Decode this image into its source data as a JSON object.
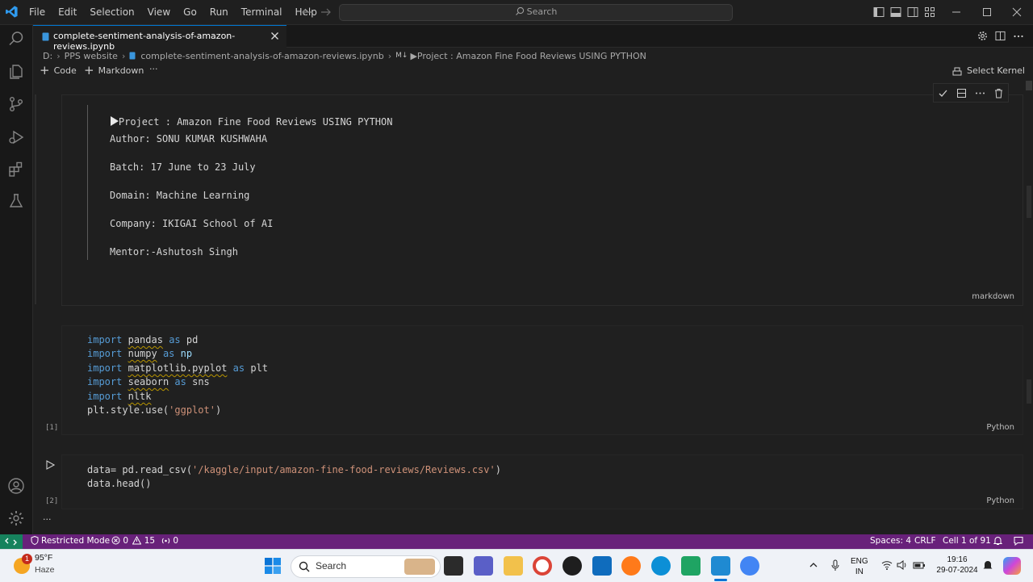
{
  "menu": [
    "File",
    "Edit",
    "Selection",
    "View",
    "Go",
    "Run",
    "Terminal",
    "Help"
  ],
  "search": {
    "label": "Search"
  },
  "tab": {
    "title": "complete-sentiment-analysis-of-amazon-reviews.ipynb"
  },
  "breadcrumb": {
    "drive": "D:",
    "folder": "PPS website",
    "file": "complete-sentiment-analysis-of-amazon-reviews.ipynb",
    "section_prefix": "M↓",
    "section": "▶Project : Amazon Fine Food Reviews USING PYTHON"
  },
  "toolbar": {
    "code": "Code",
    "markdown": "Markdown",
    "more": "···",
    "kernel": "Select Kernel"
  },
  "markdown_cell": {
    "heading": "Project : Amazon Fine Food Reviews USING PYTHON",
    "lines": [
      "Author: SONU KUMAR KUSHWAHA",
      "Batch: 17 June to 23 July",
      "Domain: Machine Learning",
      "Company: IKIGAI School of AI",
      "Mentor:-Ashutosh Singh"
    ],
    "label": "markdown"
  },
  "code_cell_1": {
    "exec": "[1]",
    "language": "Python",
    "lines": {
      "l1": {
        "kw": "import",
        "mod": "pandas",
        "as": "as",
        "alias": "pd"
      },
      "l2": {
        "kw": "import",
        "mod": "numpy",
        "as": "as",
        "alias": "np"
      },
      "l3": {
        "kw": "import",
        "mod": "matplotlib.pyplot",
        "as": "as",
        "alias": "plt"
      },
      "l4": {
        "kw": "import",
        "mod": "seaborn",
        "as": "as",
        "alias": "sns"
      },
      "l5": {
        "kw": "import",
        "mod": "nltk"
      },
      "l6": {
        "pre": "plt.style.use(",
        "str": "'ggplot'",
        "post": ")"
      }
    }
  },
  "code_cell_2": {
    "exec": "[2]",
    "language": "Python",
    "line1": {
      "pre": "data= pd.read_csv(",
      "str": "'/kaggle/input/amazon-fine-food-reviews/Reviews.csv'",
      "post": ")"
    },
    "line2": "data.head()"
  },
  "more_cells": "···",
  "status": {
    "restricted": "Restricted Mode",
    "errors": "0",
    "warnings": "15",
    "ports": "0",
    "spaces": "Spaces: 4",
    "eol": "CRLF",
    "cell": "Cell 1 of 91"
  },
  "taskbar": {
    "weather_temp": "95°F",
    "weather_desc": "Haze",
    "weather_badge": "1",
    "search": "Search",
    "lang1": "ENG",
    "lang2": "IN",
    "time": "19:16",
    "date": "29-07-2024"
  },
  "colors": {
    "accent": "#0078d4",
    "statusbar": "#68217a",
    "remote": "#16825d",
    "keyword": "#569cd6",
    "string": "#ce9178"
  }
}
